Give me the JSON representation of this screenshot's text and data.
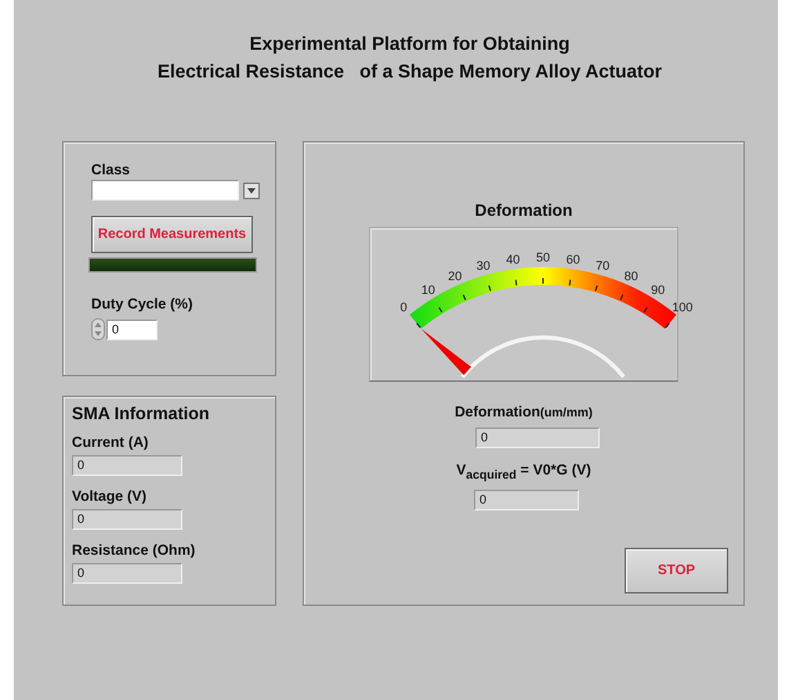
{
  "title": [
    "Experimental Platform for Obtaining",
    "Electrical Resistance   of a Shape Memory Alloy Actuator"
  ],
  "controls": {
    "class": {
      "label": "Class"
    },
    "record_button": "Record Measurements",
    "led": {
      "on": false
    },
    "duty_cycle": {
      "label": "Duty Cycle (%)",
      "value": "0"
    }
  },
  "sma_information": {
    "title": "SMA Information",
    "fields": [
      {
        "label": "Current (A)",
        "value": "0"
      },
      {
        "label": "Voltage (V)",
        "value": "0"
      },
      {
        "label": "Resistance (Ohm)",
        "value": "0"
      }
    ]
  },
  "gauge": {
    "title": "Deformation",
    "scale": [
      "0",
      "10",
      "20",
      "30",
      "40",
      "50",
      "60",
      "70",
      "80",
      "90",
      "100"
    ]
  },
  "deformation": {
    "label": "Deformation",
    "unit": "(um/mm)",
    "value": "0"
  },
  "v_acquired": {
    "label": "V$_{acquired}$ = V0*G (V)",
    "value": "0"
  },
  "stop_button": "STOP"
}
